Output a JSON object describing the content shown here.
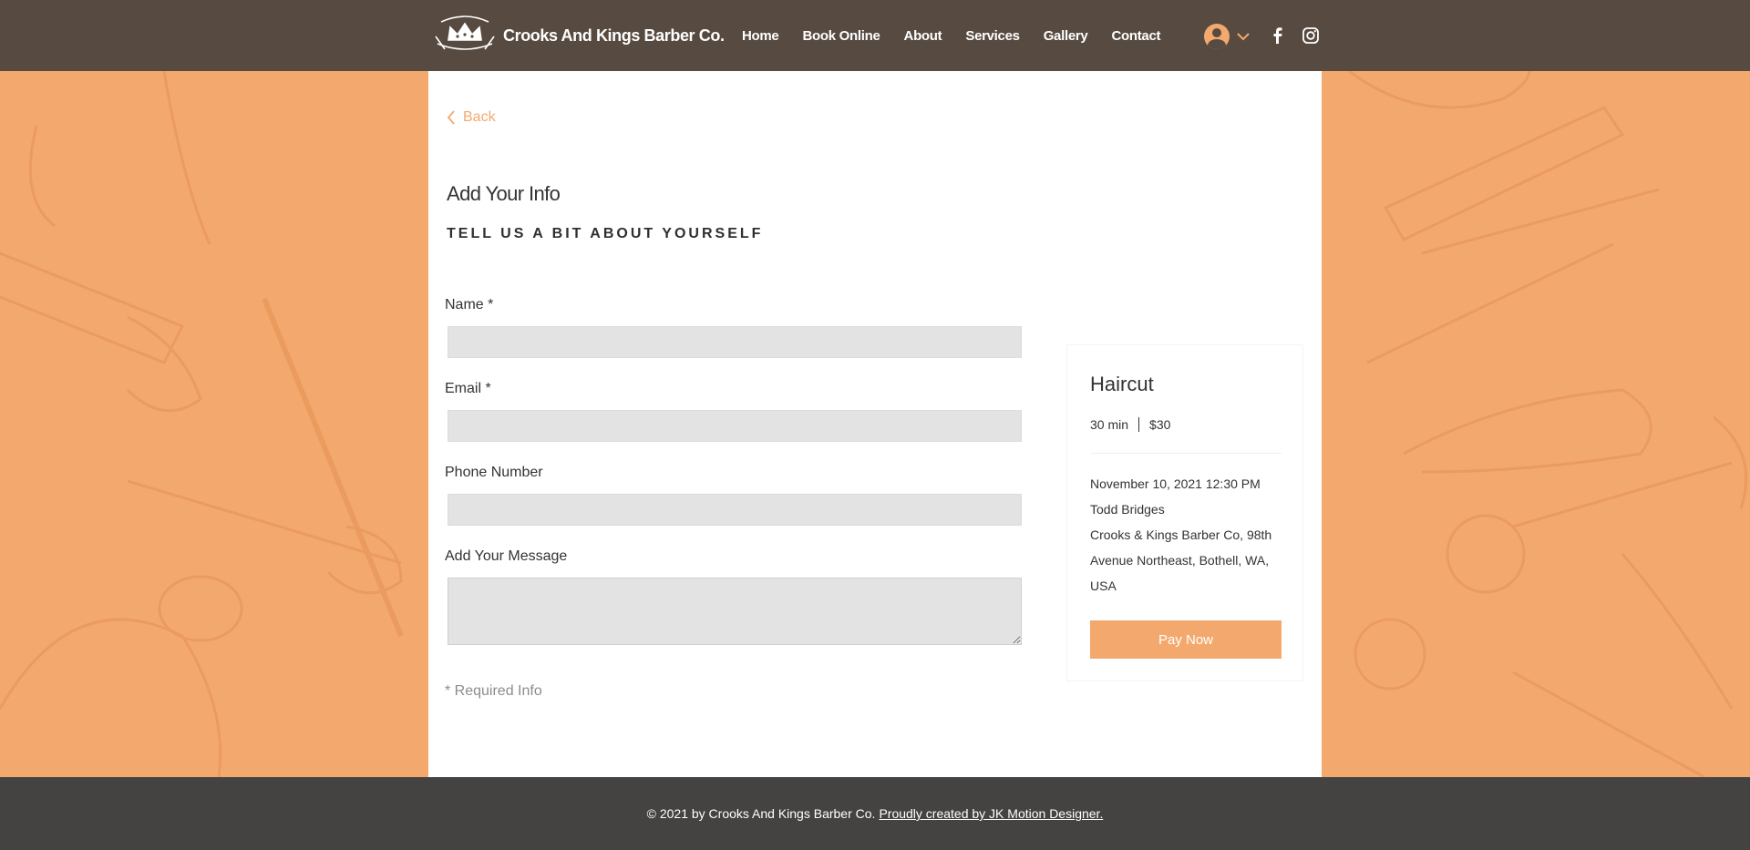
{
  "header": {
    "brand": "Crooks And Kings Barber Co.",
    "nav": [
      "Home",
      "Book Online",
      "About",
      "Services",
      "Gallery",
      "Contact"
    ],
    "logo_text": "Crooks & Kings Barber Co."
  },
  "form": {
    "back_label": "Back",
    "title": "Add Your Info",
    "subtitle": "TELL US A BIT ABOUT YOURSELF",
    "name_label": "Name *",
    "email_label": "Email *",
    "phone_label": "Phone Number",
    "message_label": "Add Your Message",
    "required_note": "* Required Info"
  },
  "summary": {
    "service": "Haircut",
    "duration": "30 min",
    "price": "$30",
    "datetime": "November 10, 2021 12:30 PM",
    "staff": "Todd Bridges",
    "location": "Crooks & Kings Barber Co, 98th Avenue Northeast, Bothell, WA, USA",
    "pay_label": "Pay Now"
  },
  "footer": {
    "copyright": "© 2021 by Crooks And Kings Barber Co.",
    "credit": "Proudly created by JK Motion Designer."
  },
  "colors": {
    "accent": "#f3a96d",
    "header_bg": "#574a40",
    "footer_bg": "#444342"
  },
  "icons": [
    "crown-logo-icon",
    "user-avatar-icon",
    "chevron-down-icon",
    "facebook-icon",
    "instagram-icon",
    "chevron-left-icon"
  ]
}
